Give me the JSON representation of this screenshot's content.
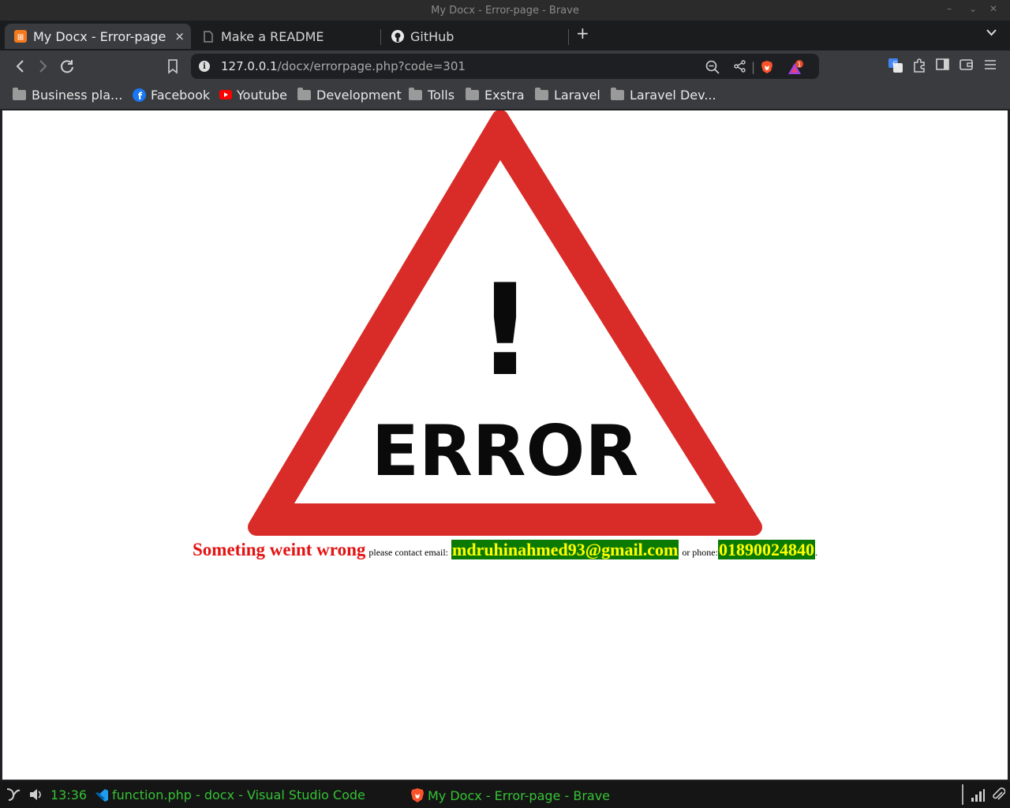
{
  "window": {
    "title": "My Docx - Error-page - Brave"
  },
  "tabs": [
    {
      "label": "My Docx - Error-page",
      "icon": "xampp-icon",
      "active": true
    },
    {
      "label": "Make a README",
      "icon": "document-icon",
      "active": false
    },
    {
      "label": "GitHub",
      "icon": "github-icon",
      "active": false
    }
  ],
  "tab_close": "×",
  "new_tab": "+",
  "address": {
    "host": "127.0.0.1",
    "path": "/docx/errorpage.php?code=301",
    "rewards_badge": "1"
  },
  "bookmarks": [
    {
      "label": "Business pla...",
      "icon": "folder-icon"
    },
    {
      "label": "Facebook",
      "icon": "facebook-icon"
    },
    {
      "label": "Youtube",
      "icon": "youtube-icon"
    },
    {
      "label": "Development",
      "icon": "folder-icon"
    },
    {
      "label": "Tolls",
      "icon": "folder-icon"
    },
    {
      "label": "Exstra",
      "icon": "folder-icon"
    },
    {
      "label": "Laravel",
      "icon": "folder-icon"
    },
    {
      "label": "Laravel Dev...",
      "icon": "folder-icon"
    }
  ],
  "page": {
    "sign_text": "ERROR",
    "sign_symbol": "!",
    "message": "Someting weint wrong",
    "contact_prefix": "please contact email:",
    "email": "mdruhinahmed93@gmail.com",
    "phone_prefix": "or phone:",
    "phone": "01890024840",
    "suffix": ".",
    "colors": {
      "sign_red": "#d92b27",
      "message_red": "#e41313",
      "highlight_bg": "#0b7a05",
      "highlight_text": "#ffff00"
    }
  },
  "taskbar": {
    "clock": "13:36",
    "tasks": [
      {
        "label": "function.php - docx - Visual Studio Code",
        "icon": "vscode-icon"
      },
      {
        "label": "My Docx - Error-page - Brave",
        "icon": "brave-icon"
      }
    ],
    "text_color": "#35c235"
  }
}
